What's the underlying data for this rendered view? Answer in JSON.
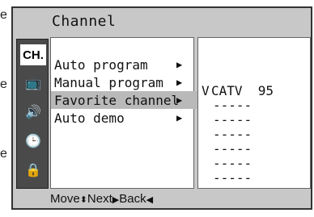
{
  "side_text": [
    "e",
    "e",
    "e"
  ],
  "title": "Channel",
  "icons": [
    {
      "label": "CH.",
      "name": "channel-icon"
    },
    {
      "label": "📺",
      "name": "picture-icon"
    },
    {
      "label": "🔊",
      "name": "sound-icon"
    },
    {
      "label": "🕒",
      "name": "clock-icon"
    },
    {
      "label": "🔒",
      "name": "lock-icon"
    }
  ],
  "menu": [
    {
      "label": "Auto program",
      "arrow": "▶"
    },
    {
      "label": "Manual program",
      "arrow": "▶"
    },
    {
      "label": "Favorite channel",
      "arrow": "▶",
      "highlighted": true
    },
    {
      "label": "Auto demo",
      "arrow": "▶"
    }
  ],
  "favorites": {
    "mark": "V",
    "first": "CATV  95",
    "slots": [
      "-----",
      "-----",
      "-----",
      "-----",
      "-----",
      "-----",
      "-----"
    ]
  },
  "help": {
    "move": "Move",
    "move_sym": "⬍",
    "next": "Next",
    "next_sym": "▶",
    "back": "Back",
    "back_sym": "◀"
  }
}
